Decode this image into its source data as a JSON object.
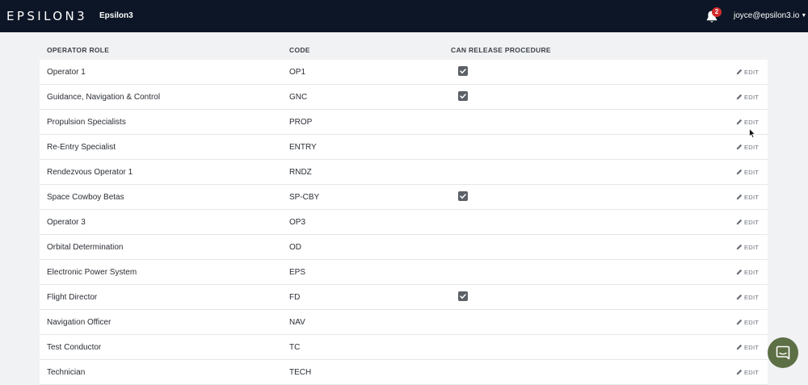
{
  "header": {
    "logo": "EPSILON3",
    "workspace": "Epsilon3",
    "notifications_count": "2",
    "user_email": "joyce@epsilon3.io",
    "caret": "▼"
  },
  "table": {
    "columns": [
      "OPERATOR ROLE",
      "CODE",
      "CAN RELEASE PROCEDURE"
    ],
    "edit_label": "EDIT",
    "rows": [
      {
        "role": "Operator 1",
        "code": "OP1",
        "can_release": true
      },
      {
        "role": "Guidance, Navigation & Control",
        "code": "GNC",
        "can_release": true
      },
      {
        "role": "Propulsion Specialists",
        "code": "PROP",
        "can_release": false
      },
      {
        "role": "Re-Entry Specialist",
        "code": "ENTRY",
        "can_release": false
      },
      {
        "role": "Rendezvous Operator 1",
        "code": "RNDZ",
        "can_release": false
      },
      {
        "role": "Space Cowboy Betas",
        "code": "SP-CBY",
        "can_release": true
      },
      {
        "role": "Operator 3",
        "code": "OP3",
        "can_release": false
      },
      {
        "role": "Orbital Determination",
        "code": "OD",
        "can_release": false
      },
      {
        "role": "Electronic Power System",
        "code": "EPS",
        "can_release": false
      },
      {
        "role": "Flight Director",
        "code": "FD",
        "can_release": true
      },
      {
        "role": "Navigation Officer",
        "code": "NAV",
        "can_release": false
      },
      {
        "role": "Test Conductor",
        "code": "TC",
        "can_release": false
      },
      {
        "role": "Technician",
        "code": "TECH",
        "can_release": false
      }
    ]
  },
  "icons": {
    "bell": "bell-icon",
    "edit": "pencil-icon",
    "check": "checkmark-icon",
    "chat": "chat-bubble-icon",
    "cursor": "mouse-pointer-icon"
  },
  "colors": {
    "topbar": "#0d1626",
    "background": "#f1f2f3",
    "checkbox": "#5c6168",
    "badge": "#d22c2c",
    "chat_button": "#5d6f45"
  }
}
